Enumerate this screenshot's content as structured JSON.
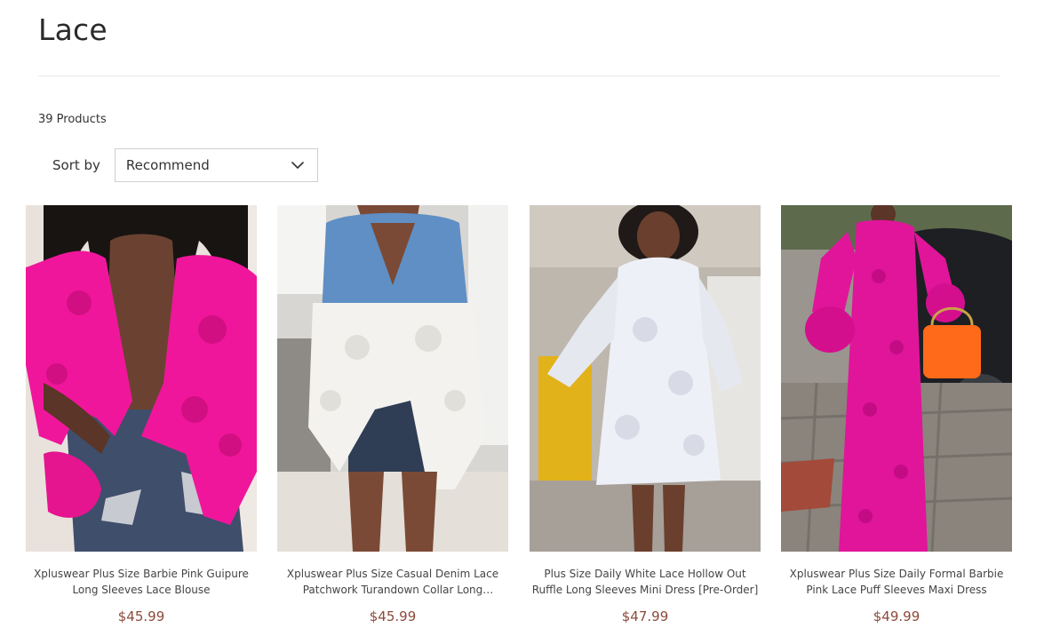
{
  "page": {
    "title": "Lace",
    "product_count": "39 Products"
  },
  "sort": {
    "label": "Sort by",
    "selected": "Recommend"
  },
  "products": [
    {
      "name": "Xpluswear Plus Size Barbie Pink Guipure Long Sleeves Lace Blouse",
      "price": "$45.99",
      "colors": {
        "bg": "#e9e2dc",
        "garment": "#f0169b",
        "accent": "#2a2f45"
      }
    },
    {
      "name": "Xpluswear Plus Size Casual Denim Lace Patchwork Turandown Collar Long Sleeves...",
      "price": "$45.99",
      "colors": {
        "bg": "#d8d6d2",
        "garment": "#f3f2ef",
        "accent": "#5f8fc4"
      }
    },
    {
      "name": "Plus Size Daily White Lace Hollow Out Ruffle Long Sleeves Mini Dress [Pre-Order]",
      "price": "$47.99",
      "colors": {
        "bg": "#bdb7ad",
        "garment": "#eef0f7",
        "accent": "#e2b21a"
      }
    },
    {
      "name": "Xpluswear Plus Size Daily Formal Barbie Pink Lace Puff Sleeves Maxi Dress",
      "price": "$49.99",
      "colors": {
        "bg": "#8e8a84",
        "garment": "#e0159a",
        "accent": "#ff6a1a"
      }
    }
  ]
}
